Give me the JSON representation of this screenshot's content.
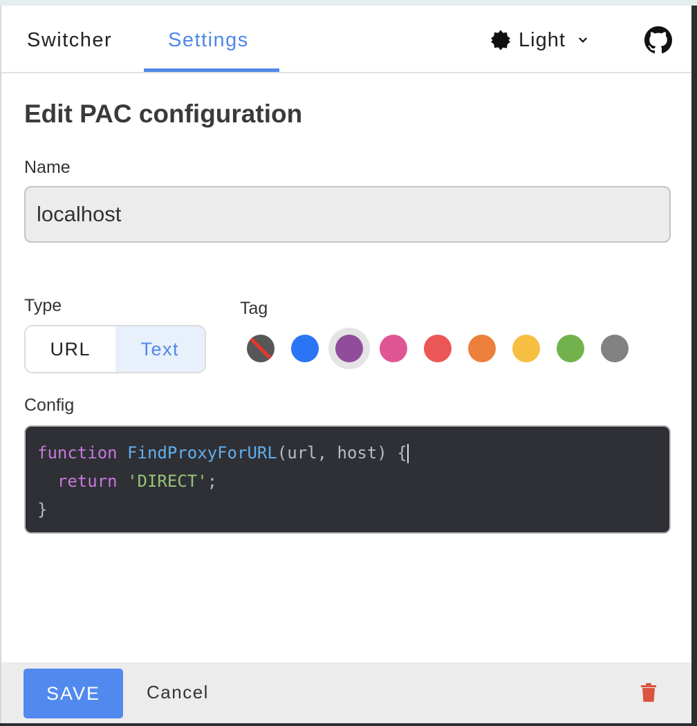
{
  "header": {
    "tabs": [
      {
        "label": "Switcher",
        "active": false
      },
      {
        "label": "Settings",
        "active": true
      }
    ],
    "theme_label": "Light",
    "icons": {
      "theme": "brightness-icon",
      "dropdown": "chevron-down-icon",
      "github": "github-icon"
    }
  },
  "page": {
    "title": "Edit PAC configuration",
    "name_label": "Name",
    "name_value": "localhost",
    "type_label": "Type",
    "type_options": [
      "URL",
      "Text"
    ],
    "type_selected": "Text",
    "tag_label": "Tag",
    "tags": [
      {
        "name": "none",
        "color": "#575757"
      },
      {
        "name": "blue",
        "color": "#2a75f6"
      },
      {
        "name": "purple",
        "color": "#914d9b",
        "selected": true
      },
      {
        "name": "pink",
        "color": "#e05594"
      },
      {
        "name": "red",
        "color": "#eb5656"
      },
      {
        "name": "orange",
        "color": "#ed7f3c"
      },
      {
        "name": "yellow",
        "color": "#f7bf41"
      },
      {
        "name": "green",
        "color": "#72b24d"
      },
      {
        "name": "gray",
        "color": "#828282"
      }
    ],
    "config_label": "Config",
    "code": {
      "l1_kw": "function",
      "l1_fn": "FindProxyForURL",
      "l1_rest": "(url, host) {",
      "l2_kw": "return",
      "l2_str": "'DIRECT'",
      "l2_rest": ";",
      "l3": "}"
    }
  },
  "footer": {
    "save_label": "SAVE",
    "cancel_label": "Cancel",
    "delete_icon": "trash-icon",
    "delete_color": "#db5440"
  }
}
